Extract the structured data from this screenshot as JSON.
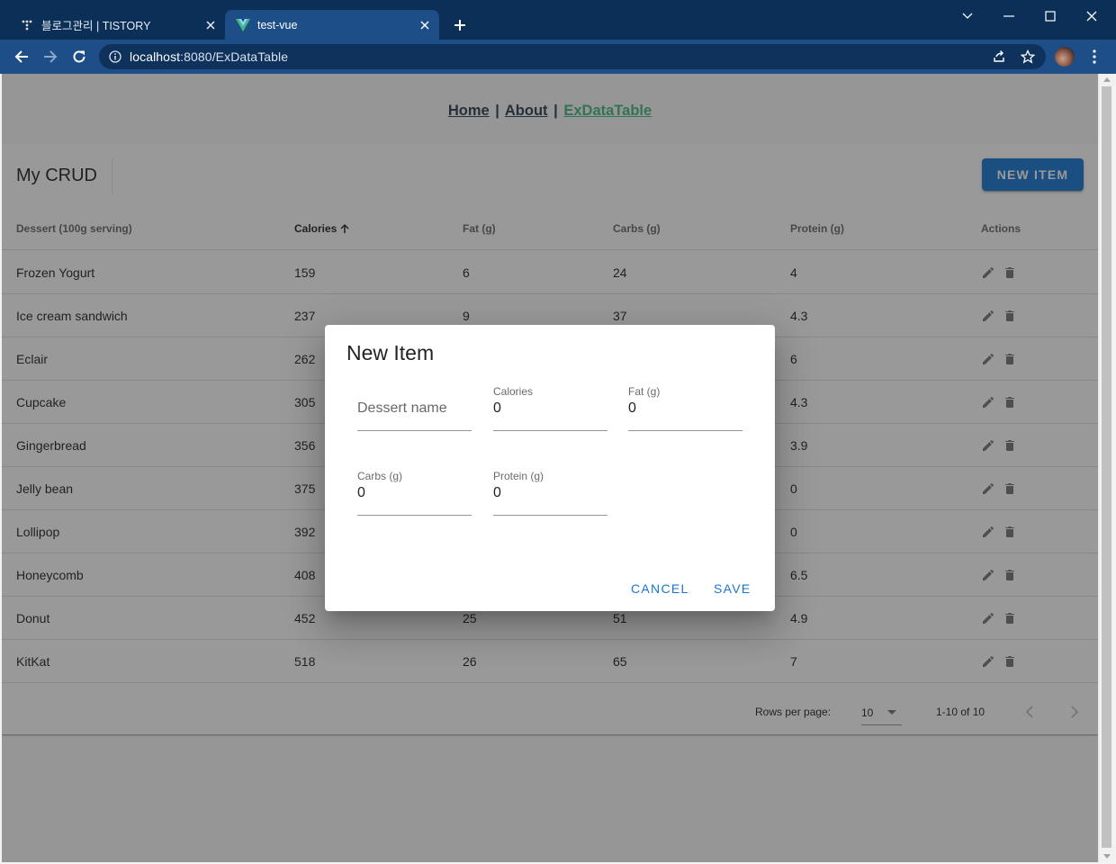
{
  "browser": {
    "tabs": [
      {
        "title": "블로그관리 | TISTORY",
        "active": false,
        "favicon": "tistory-icon"
      },
      {
        "title": "test-vue",
        "active": true,
        "favicon": "vue-icon"
      }
    ],
    "url_host": "localhost",
    "url_rest": ":8080/ExDataTable"
  },
  "nav": {
    "links": [
      "Home",
      "About",
      "ExDataTable"
    ],
    "separator": "|",
    "active": "ExDataTable"
  },
  "table": {
    "title": "My CRUD",
    "new_item_label": "NEW ITEM",
    "headers": [
      "Dessert (100g serving)",
      "Calories",
      "Fat (g)",
      "Carbs (g)",
      "Protein (g)",
      "Actions"
    ],
    "sorted_column": "Calories",
    "rows": [
      {
        "name": "Frozen Yogurt",
        "calories": "159",
        "fat": "6",
        "carbs": "24",
        "protein": "4"
      },
      {
        "name": "Ice cream sandwich",
        "calories": "237",
        "fat": "9",
        "carbs": "37",
        "protein": "4.3"
      },
      {
        "name": "Eclair",
        "calories": "262",
        "fat": "",
        "carbs": "",
        "protein": "6"
      },
      {
        "name": "Cupcake",
        "calories": "305",
        "fat": "",
        "carbs": "",
        "protein": "4.3"
      },
      {
        "name": "Gingerbread",
        "calories": "356",
        "fat": "",
        "carbs": "",
        "protein": "3.9"
      },
      {
        "name": "Jelly bean",
        "calories": "375",
        "fat": "",
        "carbs": "",
        "protein": "0"
      },
      {
        "name": "Lollipop",
        "calories": "392",
        "fat": "",
        "carbs": "",
        "protein": "0"
      },
      {
        "name": "Honeycomb",
        "calories": "408",
        "fat": "",
        "carbs": "",
        "protein": "6.5"
      },
      {
        "name": "Donut",
        "calories": "452",
        "fat": "25",
        "carbs": "51",
        "protein": "4.9"
      },
      {
        "name": "KitKat",
        "calories": "518",
        "fat": "26",
        "carbs": "65",
        "protein": "7"
      }
    ],
    "footer": {
      "rows_per_page_label": "Rows per page:",
      "rows_per_page_value": "10",
      "page_info": "1-10 of 10"
    }
  },
  "dialog": {
    "title": "New Item",
    "fields": {
      "name": {
        "placeholder": "Dessert name",
        "value": ""
      },
      "calories": {
        "label": "Calories",
        "value": "0"
      },
      "fat": {
        "label": "Fat (g)",
        "value": "0"
      },
      "carbs": {
        "label": "Carbs (g)",
        "value": "0"
      },
      "protein": {
        "label": "Protein (g)",
        "value": "0"
      }
    },
    "cancel_label": "CANCEL",
    "save_label": "SAVE"
  },
  "colors": {
    "primary": "#1976d2",
    "nav_active": "#42b983",
    "nav_text": "#2c3e50",
    "chrome_dark": "#0c2f57",
    "chrome_toolbar": "#1d4e87"
  }
}
